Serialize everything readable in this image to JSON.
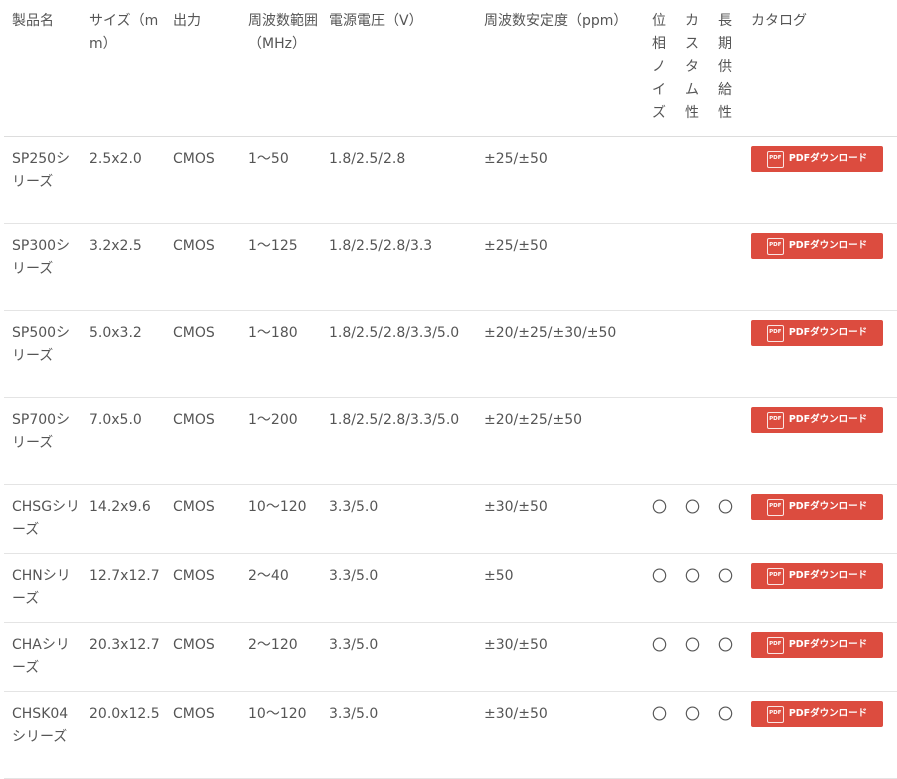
{
  "headers": {
    "name": "製品名",
    "size": "サイズ（mm）",
    "output": "出力",
    "freq": "周波数範囲（MHz）",
    "voltage": "電源電圧（V）",
    "stability": "周波数安定度（ppm）",
    "phase_noise": "位相ノイズ",
    "custom": "カスタム性",
    "long_supply": "長期供給性",
    "catalog": "カタログ"
  },
  "button": {
    "label": "PDFダウンロード",
    "icon_text": "PDF",
    "color": "#dc4c3f"
  },
  "rows": [
    {
      "name": "SP250シリーズ",
      "size": "2.5x2.0",
      "output": "CMOS",
      "freq": "1〜50",
      "voltage": "1.8/2.5/2.8",
      "stability": "±25/±50",
      "phase_noise": "",
      "custom": "",
      "long_supply": ""
    },
    {
      "name": "SP300シリーズ",
      "size": "3.2x2.5",
      "output": "CMOS",
      "freq": "1〜125",
      "voltage": "1.8/2.5/2.8/3.3",
      "stability": "±25/±50",
      "phase_noise": "",
      "custom": "",
      "long_supply": ""
    },
    {
      "name": "SP500シリーズ",
      "size": "5.0x3.2",
      "output": "CMOS",
      "freq": "1〜180",
      "voltage": "1.8/2.5/2.8/3.3/5.0",
      "stability": "±20/±25/±30/±50",
      "phase_noise": "",
      "custom": "",
      "long_supply": ""
    },
    {
      "name": "SP700シリーズ",
      "size": "7.0x5.0",
      "output": "CMOS",
      "freq": "1〜200",
      "voltage": "1.8/2.5/2.8/3.3/5.0",
      "stability": "±20/±25/±50",
      "phase_noise": "",
      "custom": "",
      "long_supply": ""
    },
    {
      "name": "CHSGシリーズ",
      "size": "14.2x9.6",
      "output": "CMOS",
      "freq": "10〜120",
      "voltage": "3.3/5.0",
      "stability": "±30/±50",
      "phase_noise": "〇",
      "custom": "〇",
      "long_supply": "〇"
    },
    {
      "name": "CHNシリーズ",
      "size": "12.7x12.7",
      "output": "CMOS",
      "freq": "2〜40",
      "voltage": "3.3/5.0",
      "stability": "±50",
      "phase_noise": "〇",
      "custom": "〇",
      "long_supply": "〇"
    },
    {
      "name": "CHAシリーズ",
      "size": "20.3x12.7",
      "output": "CMOS",
      "freq": "2〜120",
      "voltage": "3.3/5.0",
      "stability": "±30/±50",
      "phase_noise": "〇",
      "custom": "〇",
      "long_supply": "〇"
    },
    {
      "name": "CHSK04シリーズ",
      "size": "20.0x12.5",
      "output": "CMOS",
      "freq": "10〜120",
      "voltage": "3.3/5.0",
      "stability": "±30/±50",
      "phase_noise": "〇",
      "custom": "〇",
      "long_supply": "〇"
    }
  ]
}
